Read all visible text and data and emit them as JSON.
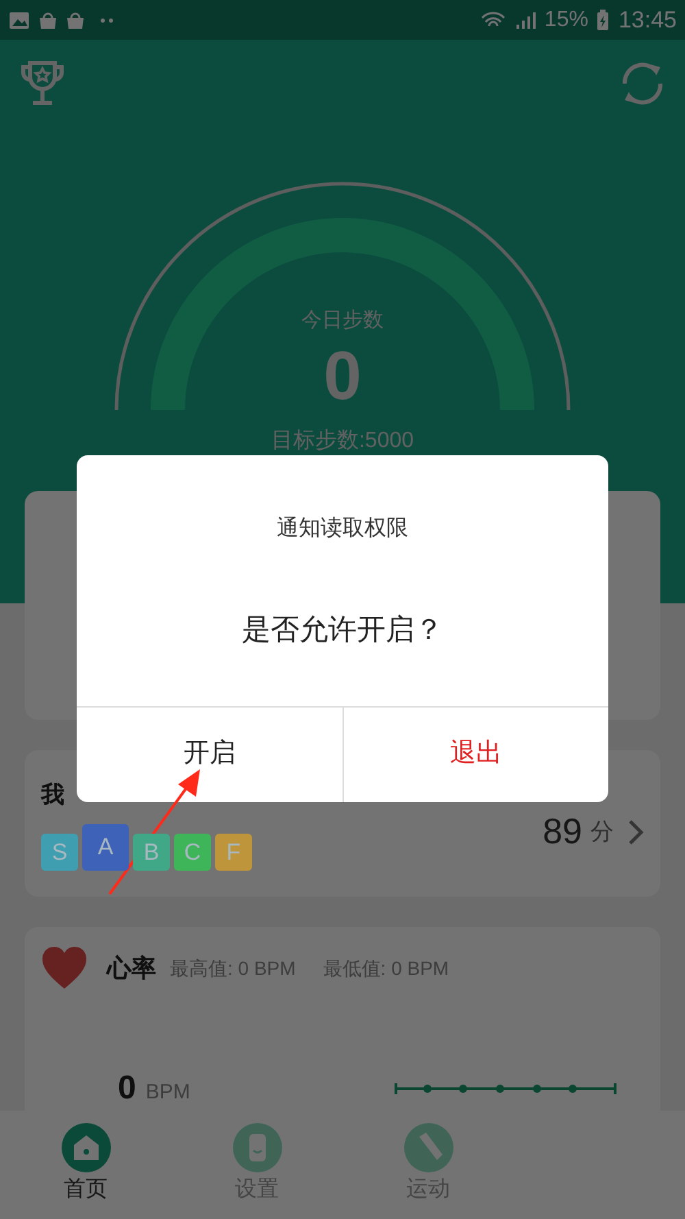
{
  "status_bar": {
    "battery": "15%",
    "time": "13:45"
  },
  "steps": {
    "label": "今日步数",
    "value": "0",
    "goal": "目标步数:5000"
  },
  "score_card": {
    "title": "我",
    "score": "89",
    "unit": "分",
    "grades": [
      {
        "label": "S",
        "color": "#3f9fb0",
        "selected": false
      },
      {
        "label": "A",
        "color": "#3e62b8",
        "selected": true
      },
      {
        "label": "B",
        "color": "#40a887",
        "selected": false
      },
      {
        "label": "C",
        "color": "#3fb55a",
        "selected": false
      },
      {
        "label": "F",
        "color": "#bf953c",
        "selected": false
      }
    ]
  },
  "heart_rate": {
    "title": "心率",
    "max": "最高值: 0 BPM",
    "min": "最低值: 0 BPM",
    "value": "0",
    "unit": "BPM"
  },
  "nav": [
    {
      "label": "首页",
      "kind": "home",
      "selected": true
    },
    {
      "label": "设置",
      "kind": "watch",
      "selected": false
    },
    {
      "label": "运动",
      "kind": "shoe",
      "selected": false
    }
  ],
  "dialog": {
    "title": "通知读取权限",
    "message": "是否允许开启？",
    "buttons": [
      {
        "label": "开启",
        "kind": "confirm"
      },
      {
        "label": "退出",
        "kind": "exit"
      }
    ]
  }
}
